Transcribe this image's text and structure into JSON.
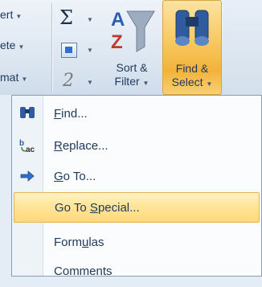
{
  "ribbon": {
    "left_items": [
      {
        "label": "ert",
        "arrow": "▼"
      },
      {
        "label": "ete",
        "arrow": "▼"
      },
      {
        "label": "mat",
        "arrow": "▼"
      }
    ],
    "autosum_symbol": "Σ",
    "dropdown_arrow": "▼",
    "sort_filter": {
      "line1": "Sort &",
      "line2": "Filter",
      "arrow": "▼",
      "letters_top": "A",
      "letters_bottom": "Z"
    },
    "find_select": {
      "line1": "Find &",
      "line2": "Select",
      "arrow": "▼"
    }
  },
  "menu": {
    "items": [
      {
        "key": "find",
        "ul": "F",
        "rest": "ind...",
        "icon": "binoculars-icon"
      },
      {
        "key": "replace",
        "ul": "R",
        "rest": "eplace...",
        "icon": "replace-icon"
      },
      {
        "key": "goto",
        "ul": "G",
        "rest": "o To...",
        "icon": "arrow-right-icon"
      },
      {
        "key": "goto_special",
        "pre": "Go To ",
        "ul": "S",
        "rest": "pecial...",
        "selected": true
      },
      {
        "key": "formulas",
        "pre": "Form",
        "ul": "u",
        "rest": "las"
      },
      {
        "key": "comments",
        "pre": "Co",
        "ul": "",
        "rest": "mments"
      }
    ]
  },
  "colors": {
    "highlight": "#ffe59a",
    "find_button": "#f7c85f",
    "text": "#1e395b"
  }
}
